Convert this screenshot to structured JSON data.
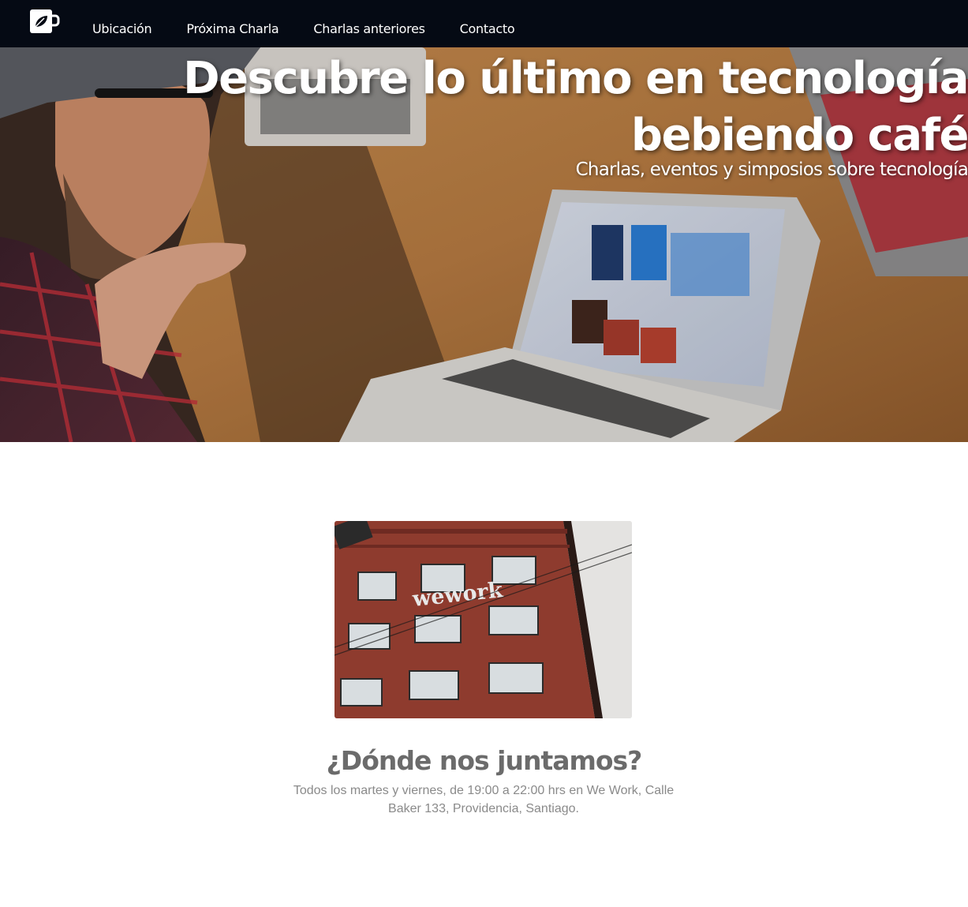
{
  "navbar": {
    "logo_icon": "coffee-mug-leaf-icon",
    "links": [
      {
        "label": "Ubicación"
      },
      {
        "label": "Próxima Charla"
      },
      {
        "label": "Charlas anteriores"
      },
      {
        "label": "Contacto"
      }
    ]
  },
  "hero": {
    "title": "Descubre lo último en tecnología bebiendo café",
    "subtitle": "Charlas, eventos y simposios sobre tecnología"
  },
  "location": {
    "photo_sign": "wework",
    "title": "¿Dónde nos juntamos?",
    "text": "Todos los martes y viernes, de 19:00 a 22:00 hrs en We Work, Calle Baker 133, Providencia, Santiago."
  },
  "colors": {
    "navbar_bg": "#050a14",
    "heading_gray": "#6b6b6b",
    "text_gray": "#8a8a8a"
  }
}
